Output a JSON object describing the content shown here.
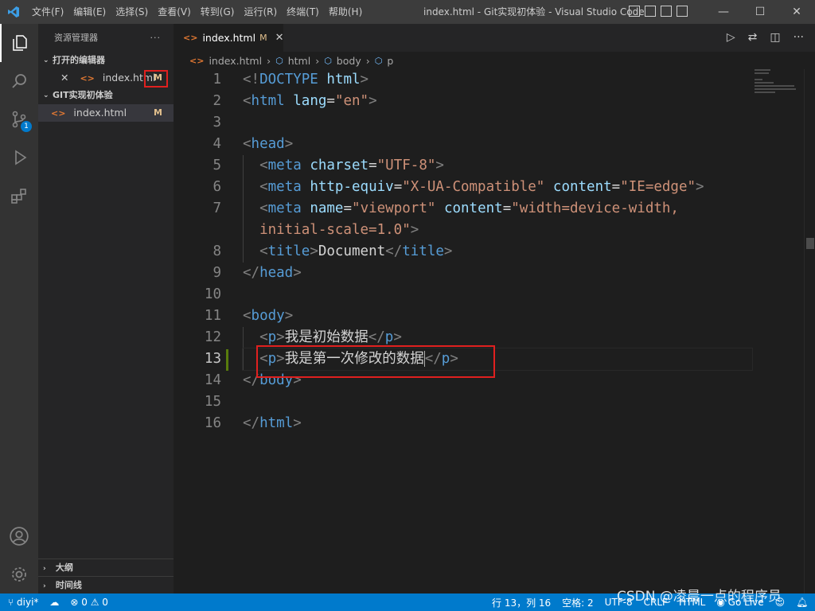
{
  "titlebar": {
    "menu": [
      "文件(F)",
      "编辑(E)",
      "选择(S)",
      "查看(V)",
      "转到(G)",
      "运行(R)",
      "终端(T)",
      "帮助(H)"
    ],
    "window_title": "index.html - Git实现初体验 - Visual Studio Code",
    "controls": [
      "—",
      "☐",
      "✕"
    ]
  },
  "activity_bar": {
    "source_control_badge": "1"
  },
  "sidebar": {
    "header": "资源管理器",
    "more": "···",
    "open_editors_title": "打开的编辑器",
    "open_editor_file": "index.html",
    "open_editor_flag": "M",
    "workspace_title": "GIT实现初体验",
    "workspace_file": "index.html",
    "workspace_flag": "M",
    "outline_title": "大纲",
    "timeline_title": "时间线"
  },
  "editor": {
    "tab_label": "index.html",
    "tab_flag": "M",
    "tab_close": "✕",
    "breadcrumb": [
      "index.html",
      "html",
      "body",
      "p"
    ],
    "line_numbers": [
      "1",
      "2",
      "3",
      "4",
      "5",
      "6",
      "7",
      "",
      "8",
      "9",
      "10",
      "11",
      "12",
      "13",
      "14",
      "15",
      "16"
    ],
    "current_line": "13",
    "code": {
      "l1": {
        "a": "<!",
        "b": "DOCTYPE",
        "c": " html",
        "d": ">"
      },
      "l2": {
        "tag": "html",
        "attr": "lang",
        "val": "\"en\""
      },
      "l4": {
        "tag": "head"
      },
      "l5": {
        "tag": "meta",
        "attr": "charset",
        "val": "\"UTF-8\""
      },
      "l6": {
        "tag": "meta",
        "attr1": "http-equiv",
        "val1": "\"X-UA-Compatible\"",
        "attr2": "content",
        "val2": "\"IE=edge\""
      },
      "l7": {
        "tag": "meta",
        "attr1": "name",
        "val1": "\"viewport\"",
        "attr2": "content",
        "val2a": "\"width=device-width,",
        "val2b": "initial-scale=1.0\""
      },
      "l8": {
        "tag": "title",
        "text": "Document"
      },
      "l9": {
        "tag": "head"
      },
      "l11": {
        "tag": "body"
      },
      "l12": {
        "tag": "p",
        "text": "我是初始数据"
      },
      "l13": {
        "tag": "p",
        "text": "我是第一次修改的数据"
      },
      "l14": {
        "tag": "body"
      },
      "l16": {
        "tag": "html"
      }
    }
  },
  "statusbar": {
    "branch": "diyi*",
    "problems": "⊗ 0 ⚠ 0",
    "position": "行 13，列 16",
    "spaces": "空格: 2",
    "encoding": "UTF-8",
    "eol": "CRLF",
    "language": "HTML",
    "golive": "Go Live"
  },
  "watermark": "CSDN @凌晨一点的程序员",
  "colors": {
    "accent": "#007acc",
    "highlight_box": "#e0201f",
    "modified": "#e2c08d"
  }
}
